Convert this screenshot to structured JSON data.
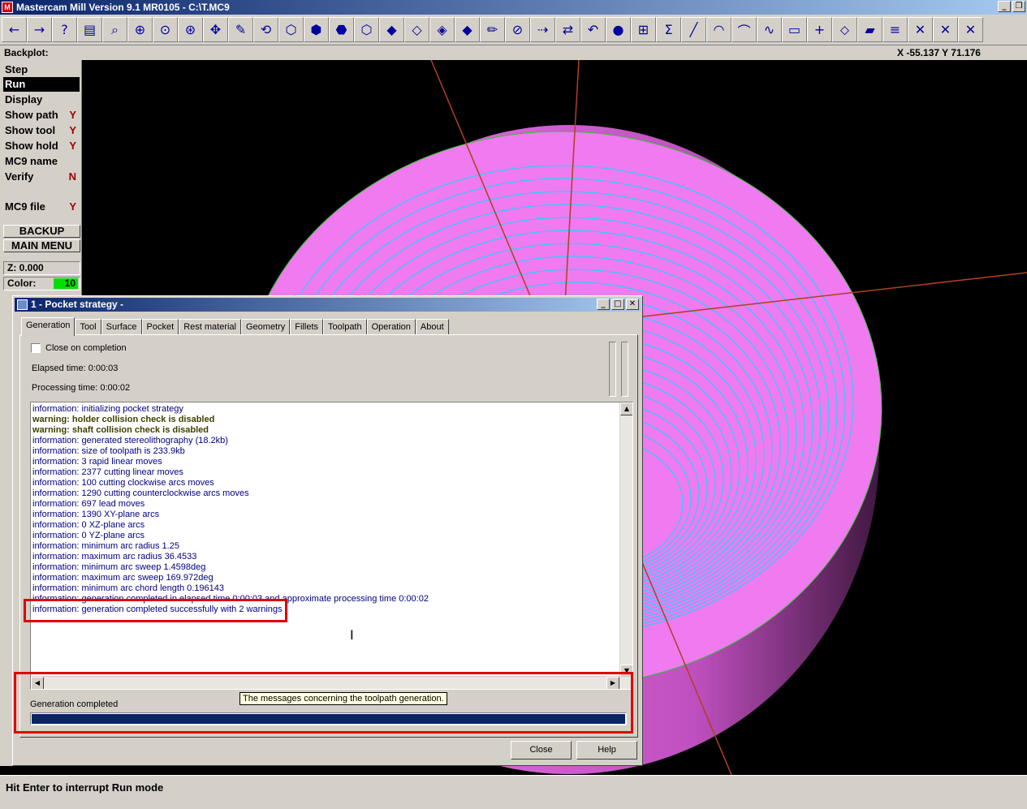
{
  "window": {
    "title": "Mastercam Mill Version 9.1 MR0105 - C:\\T.MC9",
    "app_icon": "M"
  },
  "toolbar": {
    "icons": [
      "back-arrow-icon",
      "forward-arrow-icon",
      "help-icon",
      "toolbox-icon",
      "analyze-icon",
      "zoom-window-icon",
      "zoom-fit-icon",
      "zoom-in-icon",
      "pan-icon",
      "select-icon",
      "rotate-icon",
      "iso-view-icon",
      "top-view-icon",
      "front-view-icon",
      "side-view-icon",
      "cube-view-1-icon",
      "cube-view-2-icon",
      "cube-view-3-icon",
      "cube-view-4-icon",
      "pencil-icon",
      "no-entry-icon",
      "move-icon",
      "transform-icon",
      "undo-icon",
      "sphere-icon",
      "group-icon",
      "sum-icon",
      "line-icon",
      "arc-icon",
      "fillet-icon",
      "spline-icon",
      "rectangle-icon",
      "point-icon",
      "surface-icon",
      "solid-icon",
      "layers-icon",
      "trim-icon",
      "break-icon",
      "delete-icon"
    ]
  },
  "status": {
    "label": "Backplot:",
    "coords": "X -55.137  Y 71.176"
  },
  "menu": {
    "items": [
      {
        "label": "Step",
        "flag": ""
      },
      {
        "label": "Run",
        "flag": ""
      },
      {
        "label": "Display",
        "flag": ""
      },
      {
        "label": "Show path",
        "flag": "Y"
      },
      {
        "label": "Show tool",
        "flag": "Y"
      },
      {
        "label": "Show hold",
        "flag": "Y"
      },
      {
        "label": "MC9 name",
        "flag": ""
      },
      {
        "label": "Verify",
        "flag": "N"
      },
      {
        "label": "MC9 file",
        "flag": "Y"
      }
    ],
    "backup": "BACKUP",
    "main_menu": "MAIN MENU",
    "z": "Z:   0.000",
    "color_label": "Color:",
    "color_value": "10"
  },
  "dialog": {
    "title": "1 - Pocket strategy -",
    "tabs": [
      "Generation",
      "Tool",
      "Surface",
      "Pocket",
      "Rest material",
      "Geometry",
      "Fillets",
      "Toolpath",
      "Operation",
      "About"
    ],
    "close_on_completion": "Close on completion",
    "elapsed": "Elapsed time: 0:00:03",
    "processing": "Processing time: 0:00:02",
    "log": [
      {
        "text": "information: initializing pocket strategy",
        "warn": false
      },
      {
        "text": "warning: holder collision check is disabled",
        "warn": true
      },
      {
        "text": "warning: shaft collision check is disabled",
        "warn": true
      },
      {
        "text": "information: generated stereolithography (18.2kb)",
        "warn": false
      },
      {
        "text": "information: size of toolpath is 233.9kb",
        "warn": false
      },
      {
        "text": "information: 3 rapid linear moves",
        "warn": false
      },
      {
        "text": "information: 2377 cutting linear moves",
        "warn": false
      },
      {
        "text": "information: 100 cutting clockwise arcs moves",
        "warn": false
      },
      {
        "text": "information: 1290 cutting counterclockwise arcs moves",
        "warn": false
      },
      {
        "text": "information: 697 lead moves",
        "warn": false
      },
      {
        "text": "information: 1390 XY-plane arcs",
        "warn": false
      },
      {
        "text": "information: 0 XZ-plane arcs",
        "warn": false
      },
      {
        "text": "information: 0 YZ-plane arcs",
        "warn": false
      },
      {
        "text": "information: minimum arc radius 1.25",
        "warn": false
      },
      {
        "text": "information: maximum arc radius 36.4533",
        "warn": false
      },
      {
        "text": "information: minimum arc sweep 1.4598deg",
        "warn": false
      },
      {
        "text": "information: maximum arc sweep 169.972deg",
        "warn": false
      },
      {
        "text": "information: minimum arc chord length 0.196143",
        "warn": false
      },
      {
        "text": "information: generation completed in elapsed time 0:00:03 and approximate processing time 0:00:02",
        "warn": false
      },
      {
        "text": "information: generation completed successfully with 2 warnings",
        "warn": false
      }
    ],
    "tooltip": "The messages concerning the toolpath generation.",
    "gen_status": "Generation completed",
    "progress": 1.0,
    "close_btn": "Close",
    "help_btn": "Help"
  },
  "bottom": {
    "message": "Hit Enter to interrupt Run mode"
  },
  "colors": {
    "stock": "#f07af0",
    "toolpath": "#00e0ff",
    "axis": "#b04020",
    "highlight": "#e00000"
  }
}
